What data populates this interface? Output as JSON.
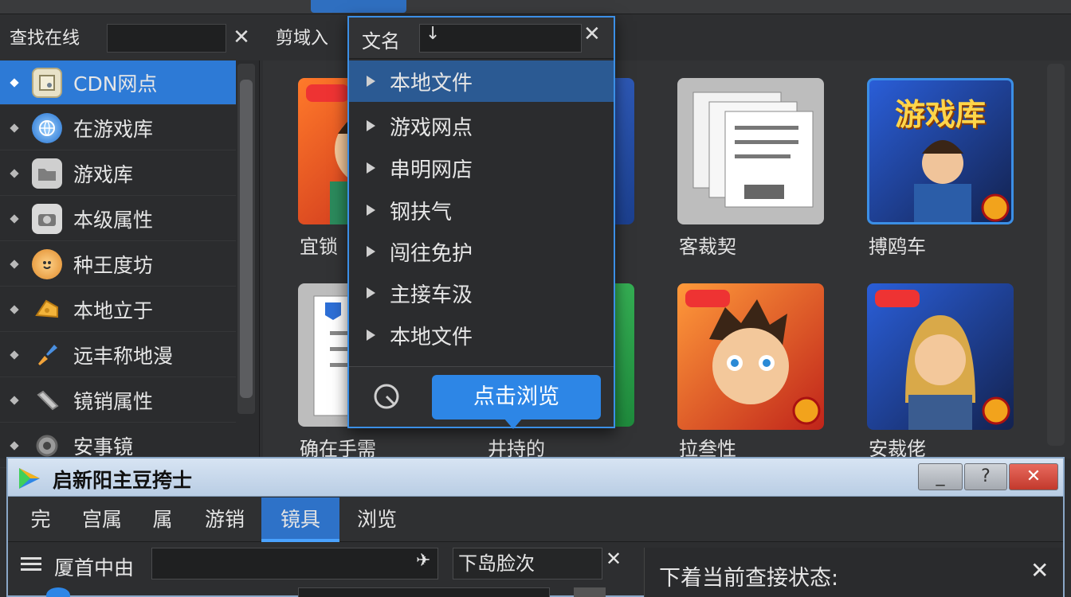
{
  "topbar": {
    "items": [
      "",
      "",
      "",
      "",
      "",
      "",
      "",
      ""
    ]
  },
  "left_search": {
    "label": "查找在线",
    "placeholder": "",
    "clear": "✕"
  },
  "sidebar": {
    "items": [
      {
        "label": "CDN网点",
        "icon": "document-icon",
        "selected": true
      },
      {
        "label": "在游戏库",
        "icon": "globe-icon",
        "selected": false
      },
      {
        "label": "游戏库",
        "icon": "folder-icon",
        "selected": false
      },
      {
        "label": "本级属性",
        "icon": "camera-icon",
        "selected": false
      },
      {
        "label": "种王度坊",
        "icon": "mascot-icon",
        "selected": false
      },
      {
        "label": "本地立于",
        "icon": "cheese-icon",
        "selected": false
      },
      {
        "label": "远丰称地漫",
        "icon": "brush-icon",
        "selected": false
      },
      {
        "label": "镜销属性",
        "icon": "pen-icon",
        "selected": false
      },
      {
        "label": "安事镜",
        "icon": "gear-icon",
        "selected": false
      }
    ]
  },
  "right_toolbar": {
    "label": "剪域入"
  },
  "dropdown": {
    "header_label": "文名",
    "header_arrow": "↓",
    "clear": "✕",
    "items": [
      {
        "label": "本地文件",
        "selected": true
      },
      {
        "label": "游戏网点",
        "selected": false
      },
      {
        "label": "串明网店",
        "selected": false
      },
      {
        "label": "钢扶气",
        "selected": false
      },
      {
        "label": "闯往免护",
        "selected": false
      },
      {
        "label": "主接车汲",
        "selected": false
      },
      {
        "label": "本地文件",
        "selected": false
      }
    ],
    "browse_button": "点击浏览"
  },
  "tiles": [
    {
      "label": "宜锁"
    },
    {
      "label": ""
    },
    {
      "label": "客裁契"
    },
    {
      "label": "搏鸥车",
      "title": "游戏库"
    },
    {
      "label": "确在手需"
    },
    {
      "label": "井持的"
    },
    {
      "label": "拉叁性"
    },
    {
      "label": "安裁佬"
    }
  ],
  "dialog": {
    "title": "启新阳主豆挎士",
    "buttons": {
      "minimize": "_",
      "help": "?",
      "close": "✕"
    },
    "tabs": [
      {
        "label": "完",
        "active": false
      },
      {
        "label": "宫属",
        "active": false
      },
      {
        "label": "属",
        "active": false
      },
      {
        "label": "游销",
        "active": false
      },
      {
        "label": "镜具",
        "active": true
      },
      {
        "label": "浏览",
        "active": false
      }
    ],
    "row_label": "厦首中由",
    "row_pin": "✈",
    "filter_text": "下岛脸次",
    "filter_clear": "✕",
    "status_text": "下着当前查接状态:",
    "status_close": "✕"
  },
  "colors": {
    "accent": "#2d7ad6",
    "dropdown_border": "#3b8fe6",
    "browse_button": "#2d86e6"
  }
}
